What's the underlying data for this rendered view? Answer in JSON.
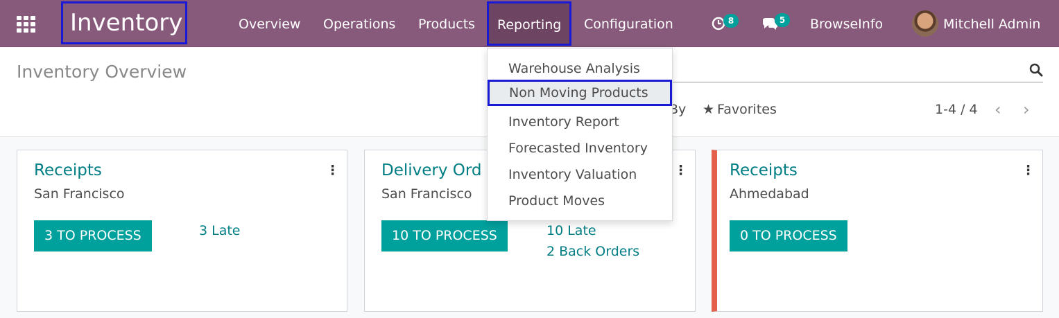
{
  "navbar": {
    "brand": "Inventory",
    "menus": [
      "Overview",
      "Operations",
      "Products",
      "Reporting",
      "Configuration"
    ],
    "activity_count": "8",
    "message_count": "5",
    "company": "BrowseInfo",
    "user": "Mitchell Admin"
  },
  "control_panel": {
    "title": "Inventory Overview",
    "groupby_fragment": "By",
    "favorites": "Favorites",
    "pager": "1-4 / 4"
  },
  "reporting_menu": {
    "items": [
      "Warehouse Analysis",
      "Non Moving Products",
      "Inventory Report",
      "Forecasted Inventory",
      "Inventory Valuation",
      "Product Moves"
    ],
    "selected": "Non Moving Products"
  },
  "cards": [
    {
      "title": "Receipts",
      "warehouse": "San Francisco",
      "button": "3 TO PROCESS",
      "links": [
        "3 Late"
      ]
    },
    {
      "title": "Delivery Ord",
      "warehouse": "San Francisco",
      "button": "10 TO PROCESS",
      "links": [
        "10 Late",
        "2 Back Orders"
      ]
    },
    {
      "title": "Receipts",
      "warehouse": "Ahmedabad",
      "button": "0 TO PROCESS",
      "links": []
    }
  ],
  "colors": {
    "navbar": "#875a7b",
    "accent": "#00a09d",
    "link": "#017e84",
    "highlight_box": "#1a1ad6",
    "card_alert": "#e4604b"
  }
}
